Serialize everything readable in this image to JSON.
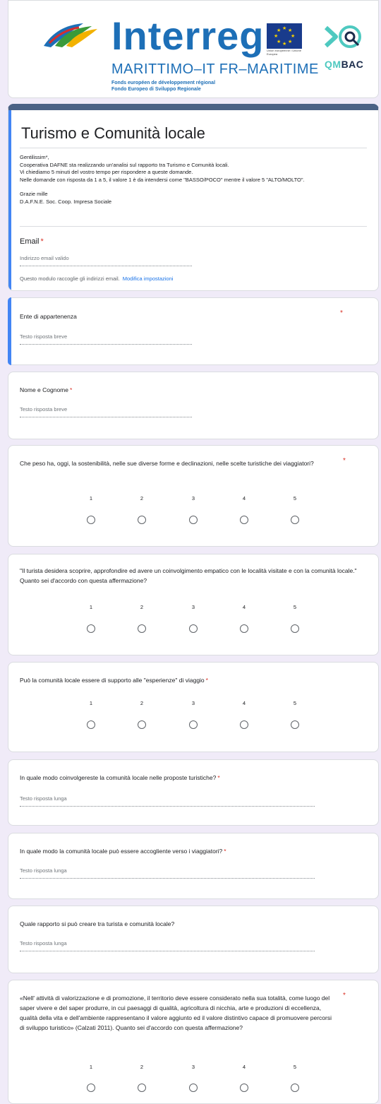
{
  "header": {
    "logo_main": "Interreg",
    "logo_sub": "MARITTIMO–IT FR–MARITIME",
    "fund_line1": "Fonds européen de développement régional",
    "fund_line2": "Fondo Europeo di Sviluppo Regionale",
    "eu_caption": "Union européenne / Unione Europea",
    "partner_logo_text_a": "QM",
    "partner_logo_text_b": "BAC"
  },
  "form": {
    "title": "Turismo e Comunità locale",
    "description": [
      "Gentilissim*,",
      "Cooperativa DAFNE sta realizzando un'analisi sul rapporto tra Turismo e Comunità locali.",
      "Vi chiediamo 5 minuti del vostro tempo per rispondere a queste domande.",
      "Nelle domande con risposta da 1 a 5, il valore 1 è da intendersi come \"BASSO/POCO\" mentre il valore 5 \"ALTO/MOLTO\".",
      "",
      "Grazie mille",
      "D.A.F.N.E. Soc. Coop. Impresa Sociale"
    ],
    "email_label": "Email",
    "email_placeholder": "Indirizzo email valido",
    "collect_note": "Questo modulo raccoglie gli indirizzi email.",
    "collect_link": "Modifica impostazioni",
    "required_mark": "*"
  },
  "questions": [
    {
      "label": "Ente di appartenenza",
      "type": "short",
      "placeholder": "Testo risposta breve"
    },
    {
      "label": "Nome e Cognome",
      "type": "short",
      "placeholder": "Testo risposta breve"
    },
    {
      "label": "Che peso ha, oggi, la sostenibilità, nelle sue diverse forme e declinazioni, nelle scelte turistiche dei viaggiatori?",
      "type": "scale",
      "scale": [
        "1",
        "2",
        "3",
        "4",
        "5"
      ]
    },
    {
      "label": "\"Il turista desidera scoprire, approfondire ed avere un coinvolgimento empatico con le località visitate e con la comunità locale.\" Quanto sei d'accordo con questa affermazione?",
      "type": "scale",
      "scale": [
        "1",
        "2",
        "3",
        "4",
        "5"
      ]
    },
    {
      "label": "Può la comunità locale essere di supporto alle  \"esperienze\" di viaggio",
      "type": "scale",
      "scale": [
        "1",
        "2",
        "3",
        "4",
        "5"
      ]
    },
    {
      "label": "In quale modo coinvolgereste la comunità locale nelle proposte turistiche?",
      "type": "long",
      "placeholder": "Testo risposta lunga"
    },
    {
      "label": "In quale modo la comunità locale può essere accogliente verso i viaggiatori?",
      "type": "long",
      "placeholder": "Testo risposta lunga"
    },
    {
      "label": "Quale rapporto si può creare tra turista e comunità locale?",
      "type": "long",
      "placeholder": "Testo risposta lunga"
    },
    {
      "label": "«Nell' attività di valorizzazione e di promozione, il territorio deve essere considerato nella sua totalità, come luogo del saper vivere e del saper produrre, in cui paesaggi di qualità, agricoltura di nicchia, arte e produzioni di eccellenza, qualità della vita e dell'ambiente rappresentano il valore aggiunto ed il valore distintivo capace di promuovere percorsi di sviluppo turistico» (Calzati 2011). Quanto sei d'accordo con questa affermazione?",
      "type": "scale",
      "scale": [
        "1",
        "2",
        "3",
        "4",
        "5"
      ]
    }
  ],
  "colors": {
    "accent": "#4285f4",
    "theme_bar": "#4b6285",
    "required": "#d93025",
    "link": "#1a73e8",
    "background": "#f0ebf8"
  }
}
